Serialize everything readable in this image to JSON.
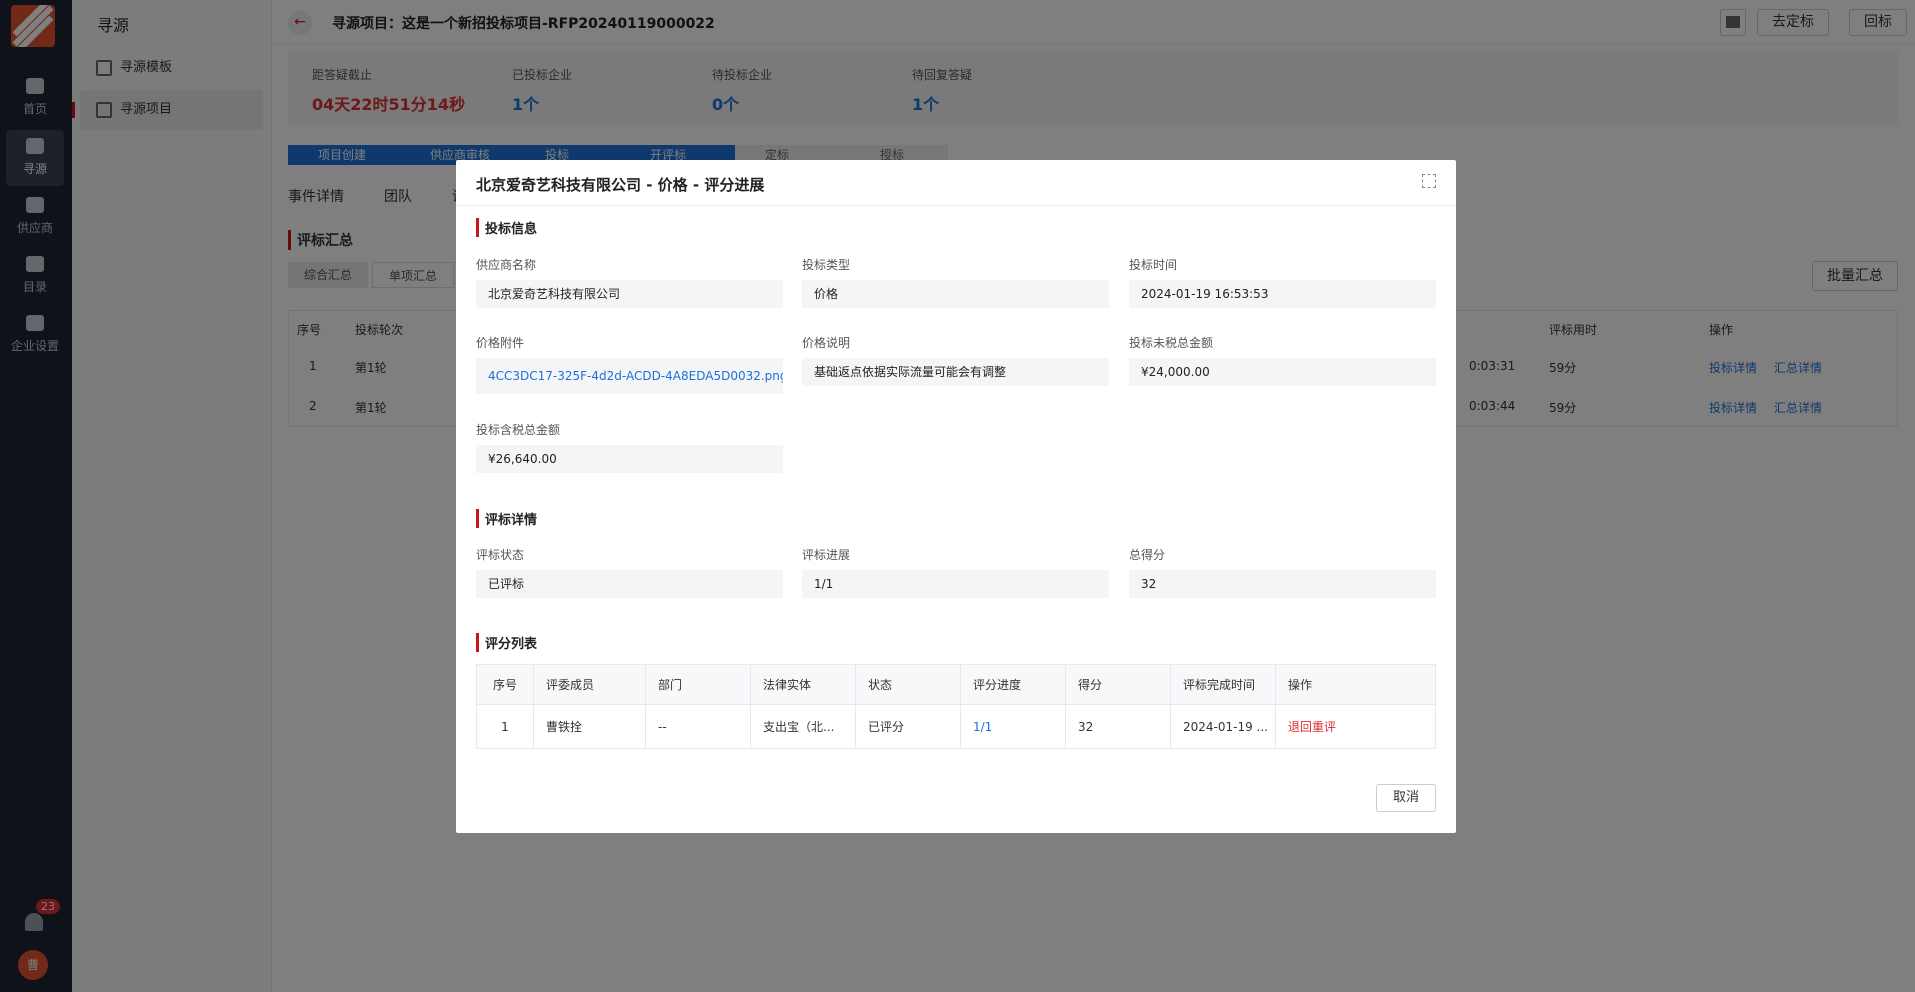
{
  "rail": {
    "items": [
      {
        "label": "首页"
      },
      {
        "label": "寻源"
      },
      {
        "label": "供应商"
      },
      {
        "label": "目录"
      },
      {
        "label": "企业设置"
      }
    ],
    "notification_count": "23",
    "avatar_text": "曹"
  },
  "subnav": {
    "title": "寻源",
    "items": [
      {
        "label": "寻源模板"
      },
      {
        "label": "寻源项目"
      }
    ]
  },
  "header": {
    "title": "寻源项目：这是一个新招投标项目-RFP20240119000022",
    "btn_define": "去定标",
    "btn_return": "回标"
  },
  "stats": [
    {
      "label": "距答疑截止",
      "value": "04天22时51分14秒"
    },
    {
      "label": "已投标企业",
      "value": "1个"
    },
    {
      "label": "待投标企业",
      "value": "0个"
    },
    {
      "label": "待回复答疑",
      "value": "1个"
    }
  ],
  "steps": [
    "项目创建",
    "供应商审核",
    "投标",
    "开评标",
    "定标",
    "授标"
  ],
  "tabs": [
    "事件详情",
    "团队",
    "评"
  ],
  "summary": {
    "title": "评标汇总",
    "segments": [
      "综合汇总",
      "单项汇总"
    ],
    "batch_label": "批量汇总"
  },
  "bg_table": {
    "headers": [
      "序号",
      "投标轮次",
      "评标用时",
      "操作"
    ],
    "rows": [
      {
        "no": "1",
        "round": "第1轮",
        "time": "0:03:31",
        "duration": "59分",
        "op1": "投标详情",
        "op2": "汇总详情"
      },
      {
        "no": "2",
        "round": "第1轮",
        "time": "0:03:44",
        "duration": "59分",
        "op1": "投标详情",
        "op2": "汇总详情"
      }
    ]
  },
  "modal": {
    "title": "北京爱奇艺科技有限公司 - 价格 - 评分进展",
    "bid_section": "投标信息",
    "fields": [
      {
        "label": "供应商名称",
        "value": "北京爱奇艺科技有限公司"
      },
      {
        "label": "投标类型",
        "value": "价格"
      },
      {
        "label": "投标时间",
        "value": "2024-01-19 16:53:53"
      },
      {
        "label": "价格附件",
        "value": "4CC3DC17-325F-4d2d-ACDD-4A8EDA5D0032.png"
      },
      {
        "label": "价格说明",
        "value": "基础返点依据实际流量可能会有调整"
      },
      {
        "label": "投标未税总金额",
        "value": "¥24,000.00"
      },
      {
        "label": "投标含税总金额",
        "value": "¥26,640.00"
      }
    ],
    "eval_section": "评标详情",
    "eval_fields": [
      {
        "label": "评标状态",
        "value": "已评标"
      },
      {
        "label": "评标进展",
        "value": "1/1"
      },
      {
        "label": "总得分",
        "value": "32"
      }
    ],
    "score_section": "评分列表",
    "score_headers": [
      "序号",
      "评委成员",
      "部门",
      "法律实体",
      "状态",
      "评分进度",
      "得分",
      "评标完成时间",
      "操作"
    ],
    "score_rows": [
      {
        "no": "1",
        "member": "曹铁拴",
        "dept": "--",
        "entity": "支出宝（北...",
        "status": "已评分",
        "progress": "1/1",
        "score": "32",
        "finish": "2024-01-19 ...",
        "action": "退回重评"
      }
    ],
    "cancel_label": "取消"
  }
}
